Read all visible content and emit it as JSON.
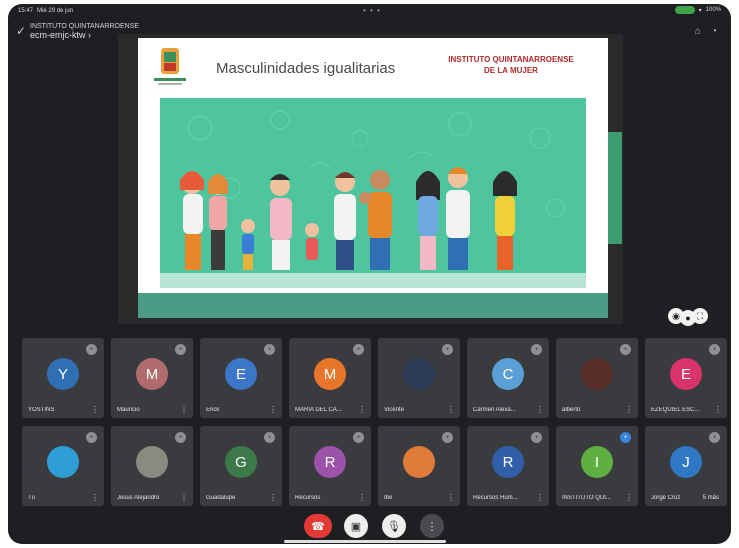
{
  "status_bar": {
    "time": "15:47",
    "date": "Mié 29 de jun",
    "battery": "100%"
  },
  "meeting": {
    "title": "INSTITUTO QUINTANARROENSE",
    "code": "ecm-emjc-ktw"
  },
  "slide": {
    "title": "Masculinidades igualitarias",
    "institute_line1": "INSTITUTO QUINTANARROENSE",
    "institute_line2": "DE LA MUJER",
    "logo_caption": "QUINTANA ROO"
  },
  "participants": [
    {
      "initial": "Y",
      "name": "YOSTINS",
      "color": "#2f6fb3"
    },
    {
      "initial": "M",
      "name": "Mauricio",
      "color": "#b06c6c"
    },
    {
      "initial": "E",
      "name": "Erick",
      "color": "#3b76c8"
    },
    {
      "initial": "M",
      "name": "MARÍA DEL CA...",
      "color": "#e8762a"
    },
    {
      "initial": "",
      "name": "Vicente",
      "color": "#2b3a55"
    },
    {
      "initial": "C",
      "name": "Carmen Alexa...",
      "color": "#5a9fd6"
    },
    {
      "initial": "",
      "name": "alberto",
      "color": "#5a2f2a"
    },
    {
      "initial": "E",
      "name": "EZEQUIEL ESC...",
      "color": "#d9336b"
    },
    {
      "initial": "",
      "name": "Tú",
      "color": "#2e9fd6"
    },
    {
      "initial": "",
      "name": "Jesus Alejandro",
      "color": "#8a8a80"
    },
    {
      "initial": "G",
      "name": "Guadalupe",
      "color": "#3d7a4a"
    },
    {
      "initial": "R",
      "name": "Recursos",
      "color": "#9c52a8"
    },
    {
      "initial": "",
      "name": "Ibe",
      "color": "#e07b3a"
    },
    {
      "initial": "R",
      "name": "Recursos Hum...",
      "color": "#2f5fa8"
    },
    {
      "initial": "I",
      "name": "INSTITUTO QUI...",
      "color": "#5fb043"
    },
    {
      "initial": "J",
      "name": "Jorge Cruz",
      "color": "#2f78c4",
      "extra": "5 más"
    }
  ],
  "colors": {
    "end_call": "#e53935",
    "tile_bg": "#3a3b3e",
    "slide_green": "#4ec59c"
  },
  "icons": {
    "end_call": "phone-hangup-icon",
    "camera": "camera-off-icon",
    "mic": "mic-off-icon",
    "more": "more-vert-icon"
  }
}
